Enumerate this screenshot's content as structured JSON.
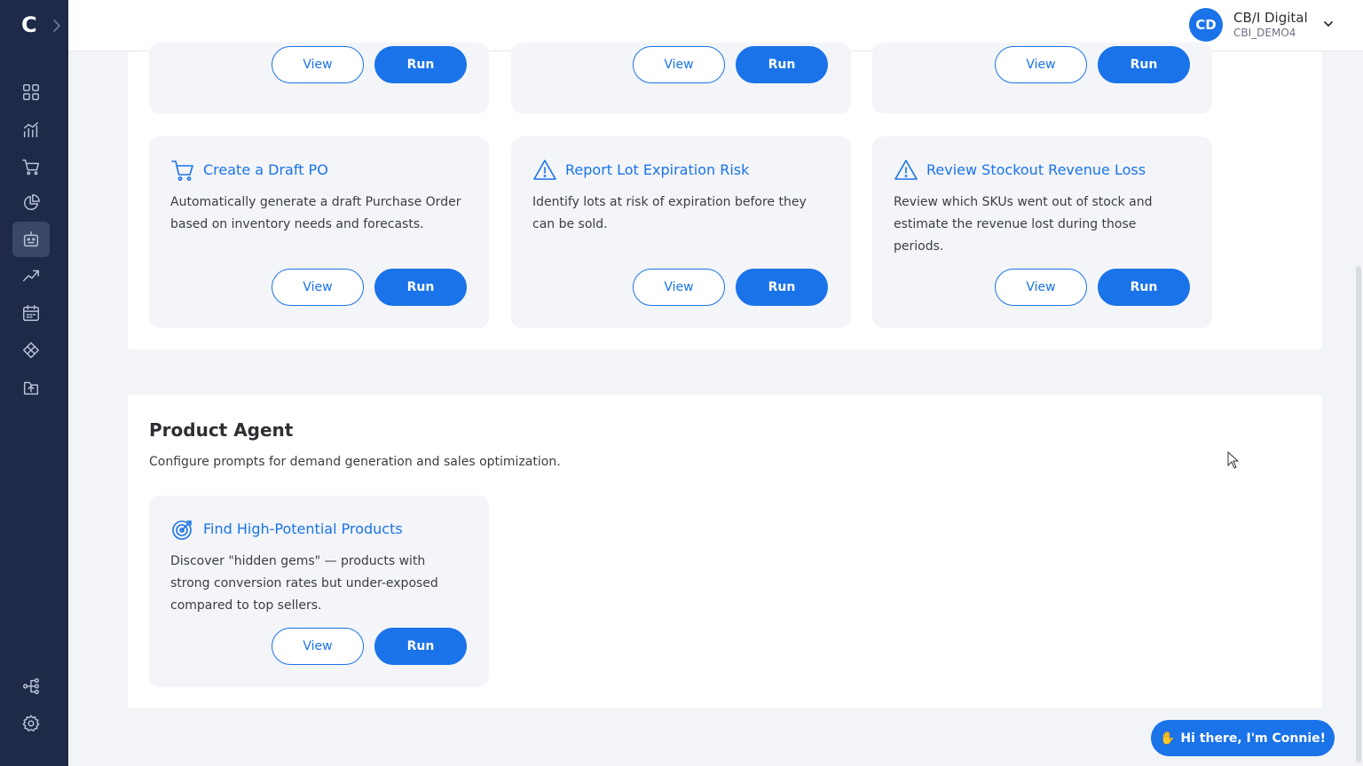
{
  "sidebar": {
    "logo": "C",
    "items": [
      {
        "icon": "grid-icon"
      },
      {
        "icon": "analytics-icon"
      },
      {
        "icon": "cart-icon"
      },
      {
        "icon": "pie-chart-icon"
      },
      {
        "icon": "robot-icon",
        "active": true
      },
      {
        "icon": "trend-icon"
      },
      {
        "icon": "calendar-icon"
      },
      {
        "icon": "diamond-icon"
      },
      {
        "icon": "upload-icon"
      },
      {
        "icon": "workflow-icon"
      },
      {
        "icon": "gear-icon"
      }
    ]
  },
  "header": {
    "avatar_initials": "CD",
    "org_name": "CB/I Digital",
    "org_code": "CBI_DEMO4"
  },
  "buttons": {
    "view": "View",
    "run": "Run"
  },
  "top_cards": [
    {
      "icon": "cart-icon",
      "title": "Create a Draft PO",
      "desc": "Automatically generate a draft Purchase Order based on inventory needs and forecasts."
    },
    {
      "icon": "warning-icon",
      "title": "Report Lot Expiration Risk",
      "desc": "Identify lots at risk of expiration before they can be sold."
    },
    {
      "icon": "warning-icon",
      "title": "Review Stockout Revenue Loss",
      "desc": "Review which SKUs went out of stock and estimate the revenue lost during those periods."
    }
  ],
  "product_agent": {
    "title": "Product Agent",
    "desc": "Configure prompts for demand generation and sales optimization.",
    "cards": [
      {
        "icon": "target-icon",
        "title": "Find High-Potential Products",
        "desc": "Discover \"hidden gems\" — products with strong conversion rates but under-exposed compared to top sellers."
      }
    ]
  },
  "chat": {
    "label": "Hi there, I'm Connie!"
  }
}
